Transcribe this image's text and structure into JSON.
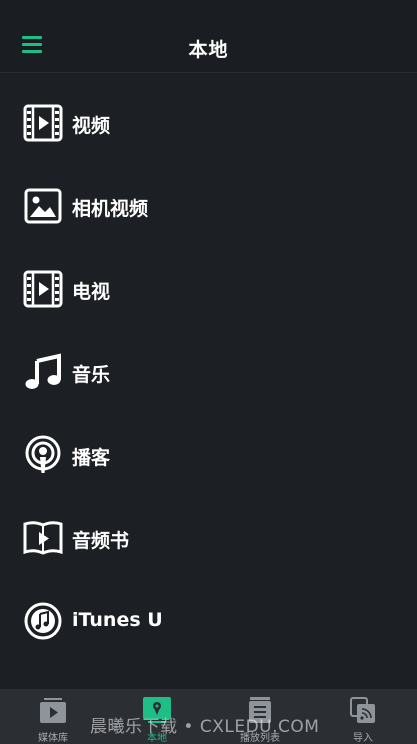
{
  "header": {
    "title": "本地",
    "menu_icon": "hamburger-menu-icon"
  },
  "items": [
    {
      "label": "视频",
      "icon": "film-icon"
    },
    {
      "label": "相机视频",
      "icon": "photo-icon"
    },
    {
      "label": "电视",
      "icon": "film-icon"
    },
    {
      "label": "音乐",
      "icon": "music-note-icon"
    },
    {
      "label": "播客",
      "icon": "podcast-icon"
    },
    {
      "label": "音频书",
      "icon": "audiobook-icon"
    },
    {
      "label": "iTunes U",
      "icon": "itunes-u-icon"
    }
  ],
  "tabs": [
    {
      "label": "媒体库",
      "icon": "media-library-icon",
      "active": false
    },
    {
      "label": "本地",
      "icon": "local-icon",
      "active": true
    },
    {
      "label": "播放列表",
      "icon": "playlist-icon",
      "active": false
    },
    {
      "label": "导入",
      "icon": "import-icon",
      "active": false
    }
  ],
  "watermark": "晨曦乐下载 • CXLEDU.COM",
  "colors": {
    "accent": "#1fbe86",
    "background": "#1c1f23",
    "tabbar": "#2b2e33"
  }
}
